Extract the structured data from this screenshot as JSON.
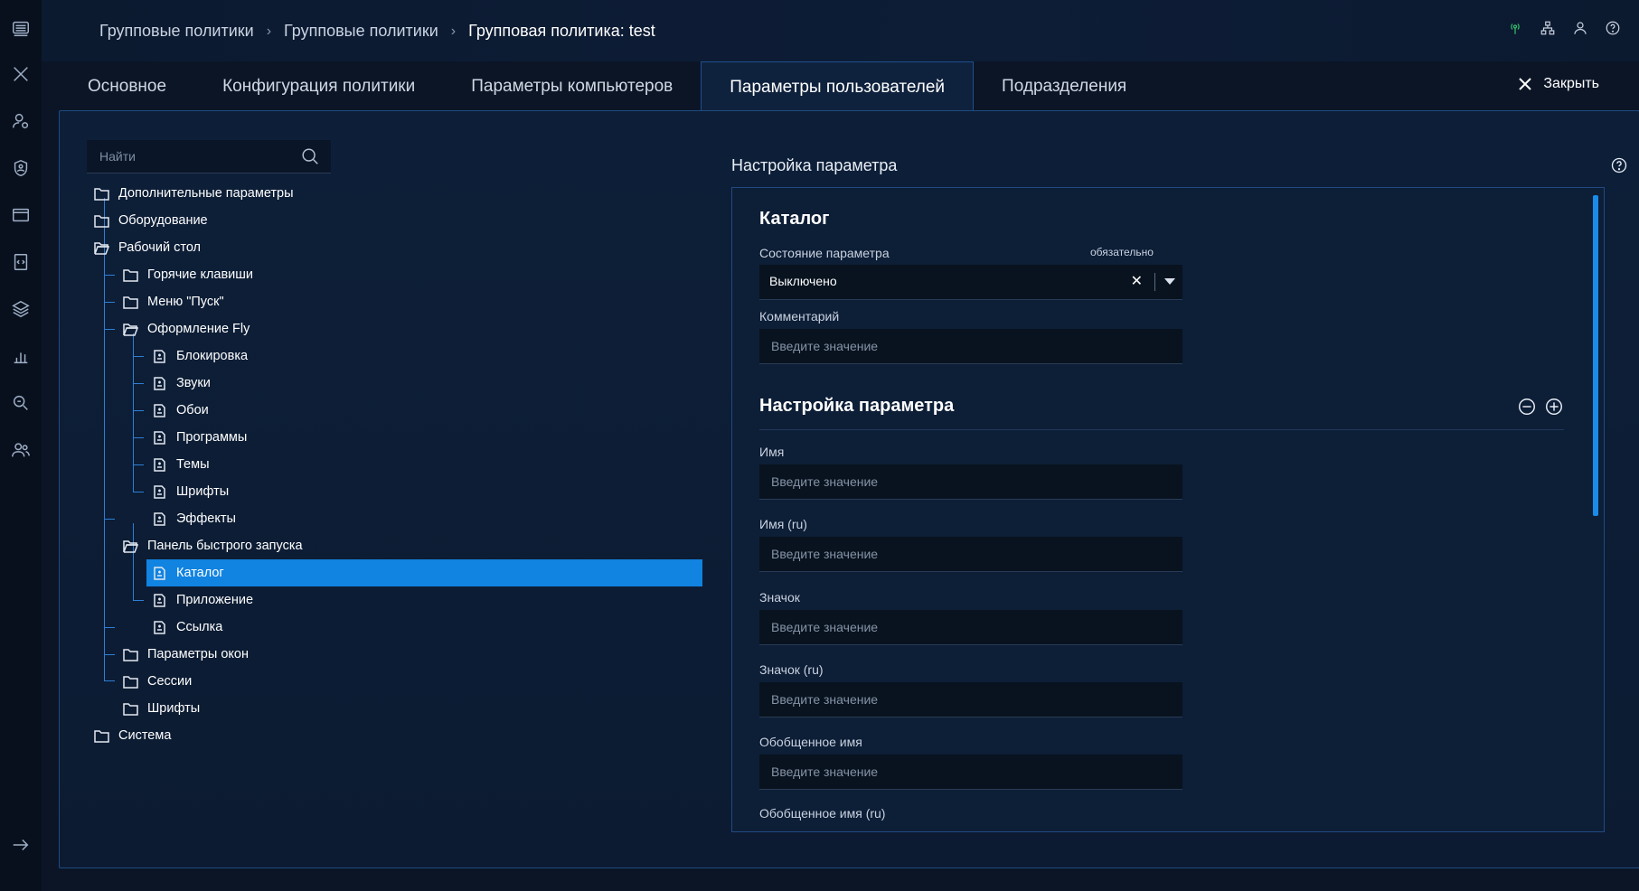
{
  "breadcrumb": {
    "items": [
      "Групповые политики",
      "Групповые политики"
    ],
    "current": "Групповая политика: test",
    "separator": "›"
  },
  "tabs": [
    "Основное",
    "Конфигурация политики",
    "Параметры компьютеров",
    "Параметры пользователей",
    "Подразделения"
  ],
  "active_tab": "Параметры пользователей",
  "close_label": "Закрыть",
  "search": {
    "placeholder": "Найти"
  },
  "tree": [
    {
      "label": "Дополнительные параметры",
      "type": "folder"
    },
    {
      "label": "Оборудование",
      "type": "folder"
    },
    {
      "label": "Рабочий стол",
      "type": "folder-open"
    },
    {
      "label": "Горячие клавиши",
      "type": "folder"
    },
    {
      "label": "Меню \"Пуск\"",
      "type": "folder"
    },
    {
      "label": "Оформление Fly",
      "type": "folder-open"
    },
    {
      "label": "Блокировка",
      "type": "item"
    },
    {
      "label": "Звуки",
      "type": "item"
    },
    {
      "label": "Обои",
      "type": "item"
    },
    {
      "label": "Программы",
      "type": "item"
    },
    {
      "label": "Темы",
      "type": "item"
    },
    {
      "label": "Шрифты",
      "type": "item"
    },
    {
      "label": "Эффекты",
      "type": "item"
    },
    {
      "label": "Панель быстрого запуска",
      "type": "folder-open"
    },
    {
      "label": "Каталог",
      "type": "item",
      "selected": true
    },
    {
      "label": "Приложение",
      "type": "item"
    },
    {
      "label": "Ссылка",
      "type": "item"
    },
    {
      "label": "Параметры окон",
      "type": "folder"
    },
    {
      "label": "Сессии",
      "type": "folder"
    },
    {
      "label": "Шрифты",
      "type": "folder"
    },
    {
      "label": "Система",
      "type": "folder"
    }
  ],
  "right": {
    "title": "Настройка параметра",
    "section_title": "Каталог",
    "state_label": "Состояние параметра",
    "required_label": "обязательно",
    "state_value": "Выключено",
    "comment_label": "Комментарий",
    "placeholder": "Введите значение",
    "subsection_title": "Настройка параметра",
    "fields": [
      "Имя",
      "Имя (ru)",
      "Значок",
      "Значок (ru)",
      "Обобщенное имя",
      "Обобщенное имя (ru)"
    ]
  },
  "colors": {
    "accent": "#1183e0",
    "background": "#0b1526",
    "panel_border": "#1f4a82"
  }
}
